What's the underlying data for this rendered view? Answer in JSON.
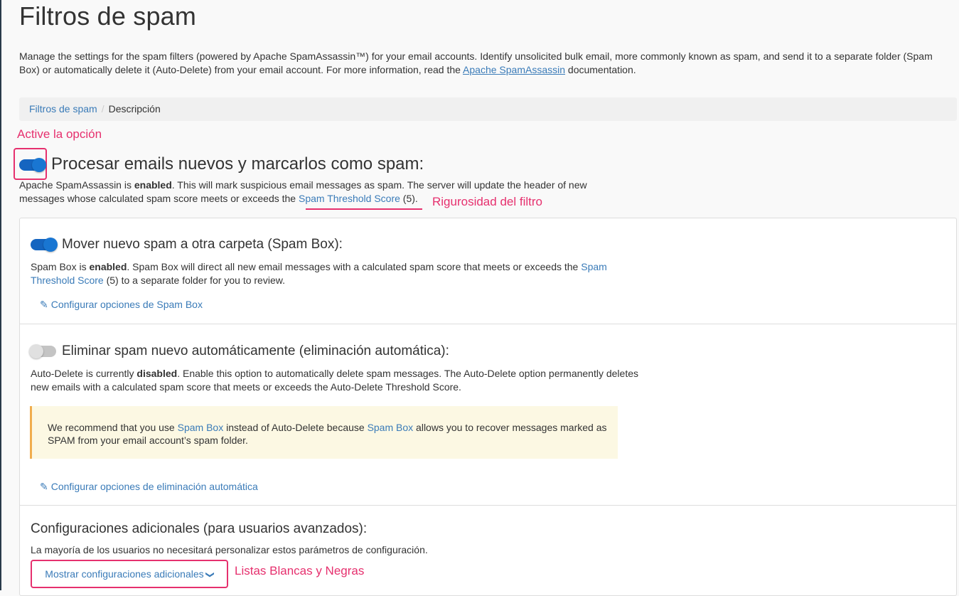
{
  "page": {
    "title": "Filtros de spam",
    "intro_before": "Manage the settings for the spam filters (powered by Apache SpamAssassin™) for your email accounts. Identify unsolicited bulk email, more commonly known as spam, and send it to a separate folder (Spam Box) or automatically delete it (Auto-Delete) from your email account. For more information, read the ",
    "intro_link": "Apache SpamAssassin",
    "intro_after": " documentation."
  },
  "breadcrumb": {
    "item1": "Filtros de spam",
    "separator": "/",
    "item2": "Descripción"
  },
  "annotations": {
    "activate": "Active la opción",
    "strictness": "Rigurosidad del filtro",
    "lists": "Listas Blancas y Negras"
  },
  "process": {
    "title": "Procesar emails nuevos y marcarlos como spam:",
    "desc1": "Apache SpamAssassin is ",
    "desc_bold": "enabled",
    "desc2": ". This will mark suspicious email messages as spam. The server will update the header of new messages whose calculated spam score meets or exceeds the ",
    "desc_link": "Spam Threshold Score",
    "desc3": " (5)."
  },
  "spambox": {
    "title": "Mover nuevo spam a otra carpeta (Spam Box):",
    "desc1": "Spam Box is ",
    "desc_bold": "enabled",
    "desc2": ". Spam Box will direct all new email messages with a calculated spam score that meets or exceeds the ",
    "desc_link": "Spam Threshold Score",
    "desc3": " (5) to a separate folder for you to review.",
    "config_link": "Configurar opciones de Spam Box"
  },
  "autodelete": {
    "title": "Eliminar spam nuevo automáticamente (eliminación automática):",
    "desc1": "Auto-Delete is currently ",
    "desc_bold": "disabled",
    "desc2": ". Enable this option to automatically delete spam messages. The Auto-Delete option permanently deletes new emails with a calculated spam score that meets or exceeds the Auto-Delete Threshold Score.",
    "warn1": "We recommend that you use ",
    "warn_link1": "Spam Box",
    "warn2": " instead of Auto-Delete because ",
    "warn_link2": "Spam Box",
    "warn3": " allows you to recover messages marked as SPAM from your email account’s spam folder.",
    "config_link": "Configurar opciones de eliminación automática"
  },
  "advanced": {
    "title": "Configuraciones adicionales (para usuarios avanzados):",
    "desc": "La mayoría de los usuarios no necesitará personalizar estos parámetros de configuración.",
    "button": "Mostrar configuraciones adicionales"
  },
  "toggles": {
    "process": "on",
    "spambox": "on",
    "autodelete": "off"
  },
  "icons": {
    "pencil": "pencil-icon",
    "chevron": "chevron-down-icon"
  },
  "colors": {
    "accent": "#3a7bb8",
    "annotation": "#e6306e",
    "toggle_on": "#1976d2",
    "warning_border": "#f0ad4e"
  }
}
